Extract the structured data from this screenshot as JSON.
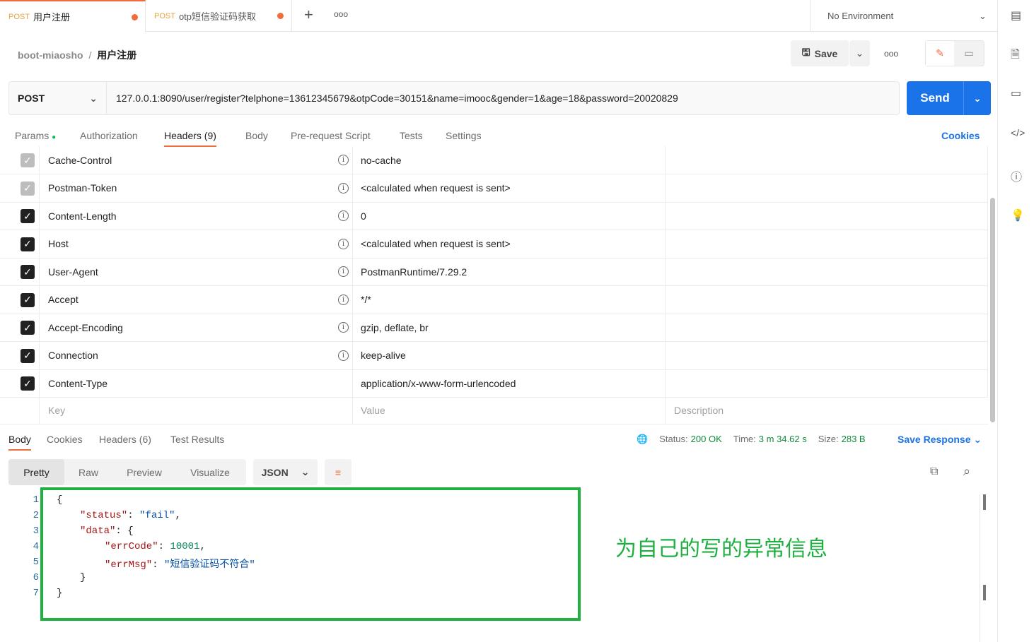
{
  "tabs": [
    {
      "method": "POST",
      "name": "用户注册"
    },
    {
      "method": "POST",
      "name": "otp短信验证码获取"
    }
  ],
  "environment": "No Environment",
  "breadcrumb": {
    "collection": "boot-miaosho",
    "request": "用户注册"
  },
  "toolbar": {
    "save": "Save"
  },
  "request": {
    "method": "POST",
    "url": "127.0.0.1:8090/user/register?telphone=13612345679&otpCode=30151&name=imooc&gender=1&age=18&password=20020829",
    "send": "Send"
  },
  "req_tabs": [
    "Params",
    "Authorization",
    "Headers (9)",
    "Body",
    "Pre-request Script",
    "Tests",
    "Settings"
  ],
  "cookies": "Cookies",
  "headers": [
    {
      "key": "Cache-Control",
      "value": "no-cache",
      "disabled": true,
      "info": true
    },
    {
      "key": "Postman-Token",
      "value": "<calculated when request is sent>",
      "disabled": true,
      "info": true
    },
    {
      "key": "Content-Length",
      "value": "0",
      "info": true
    },
    {
      "key": "Host",
      "value": "<calculated when request is sent>",
      "info": true
    },
    {
      "key": "User-Agent",
      "value": "PostmanRuntime/7.29.2",
      "info": true
    },
    {
      "key": "Accept",
      "value": "*/*",
      "info": true
    },
    {
      "key": "Accept-Encoding",
      "value": "gzip, deflate, br",
      "info": true
    },
    {
      "key": "Connection",
      "value": "keep-alive",
      "info": true
    },
    {
      "key": "Content-Type",
      "value": "application/x-www-form-urlencoded",
      "info": false
    }
  ],
  "placeholders": {
    "key": "Key",
    "value": "Value",
    "description": "Description"
  },
  "resp_tabs": [
    "Body",
    "Cookies",
    "Headers (6)",
    "Test Results"
  ],
  "status": {
    "status_label": "Status:",
    "status": "200 OK",
    "time_label": "Time:",
    "time": "3 m 34.62 s",
    "size_label": "Size:",
    "size": "283 B",
    "save_response": "Save Response"
  },
  "views": [
    "Pretty",
    "Raw",
    "Preview",
    "Visualize"
  ],
  "format": "JSON",
  "code": {
    "l1": "{",
    "k_status": "\"status\"",
    "v_status": "\"fail\"",
    "k_data": "\"data\"",
    "k_errCode": "\"errCode\"",
    "v_errCode": "10001",
    "k_errMsg": "\"errMsg\"",
    "v_errMsg": "\"短信验证码不符合\"",
    "l6": "}",
    "l7": "}"
  },
  "line_numbers": [
    "1",
    "2",
    "3",
    "4",
    "5",
    "6",
    "7"
  ],
  "annotation": "为自己的写的异常信息"
}
